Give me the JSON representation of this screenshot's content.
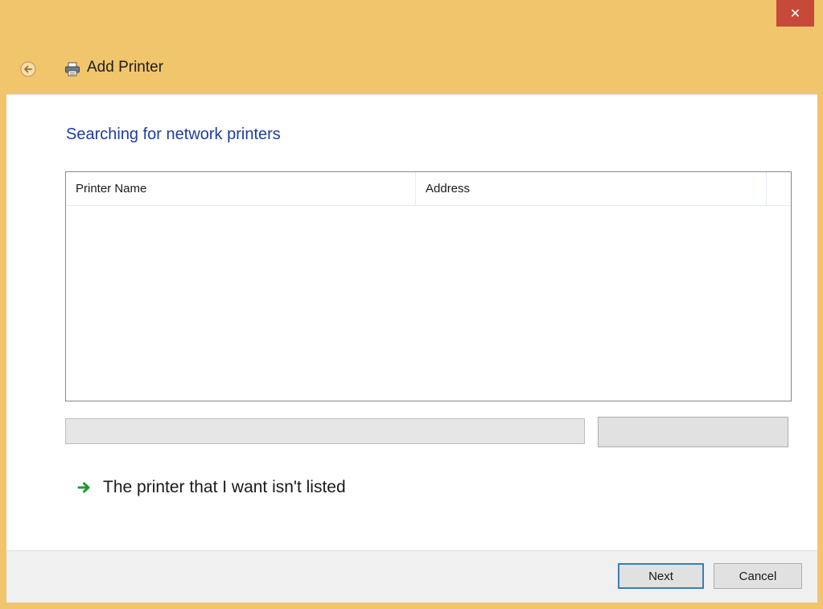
{
  "window": {
    "title": "Add Printer",
    "close_glyph": "✕",
    "accent_color": "#f1c56c"
  },
  "content": {
    "heading": "Searching for network printers",
    "list": {
      "columns": [
        "Printer Name",
        "Address",
        ""
      ],
      "rows": []
    },
    "progress": {
      "value": 0
    },
    "stop_button_label": "",
    "not_listed_link": "The printer that I want isn't listed"
  },
  "footer": {
    "next_label": "Next",
    "cancel_label": "Cancel"
  },
  "icons": {
    "back": "back-arrow-icon",
    "printer": "printer-icon",
    "link_arrow": "green-arrow-icon",
    "close": "close-icon"
  }
}
